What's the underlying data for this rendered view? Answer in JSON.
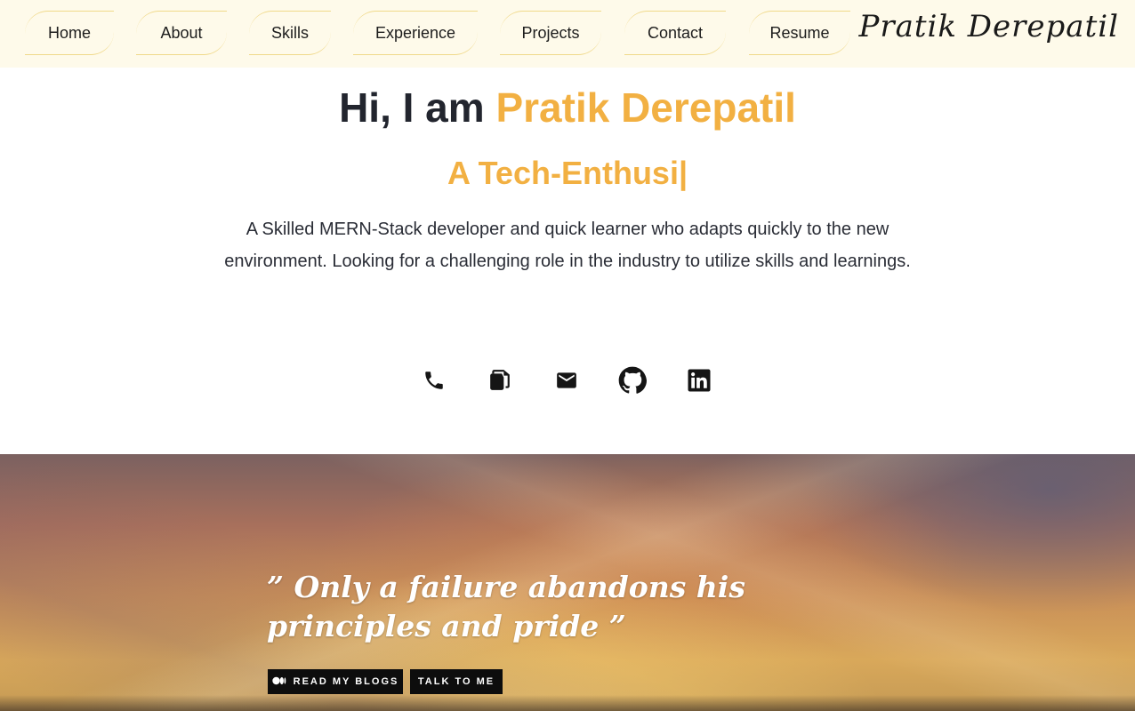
{
  "nav": {
    "items": [
      {
        "label": "Home"
      },
      {
        "label": "About"
      },
      {
        "label": "Skills"
      },
      {
        "label": "Experience"
      },
      {
        "label": "Projects"
      },
      {
        "label": "Contact"
      },
      {
        "label": "Resume"
      }
    ],
    "brand": "Pratik Derepatil"
  },
  "hero": {
    "greeting": "Hi, I am ",
    "name": "Pratik Derepatil",
    "typed_text": "A Tech-Enthusi|",
    "bio": "A Skilled MERN-Stack developer and quick learner who adapts quickly to the new environment. Looking for a challenging role in the industry to utilize skills and learnings."
  },
  "social_icons": [
    "phone-icon",
    "copy-icon",
    "email-icon",
    "github-icon",
    "linkedin-icon"
  ],
  "banner": {
    "quote_open": "” ",
    "quote": "Only a failure abandons his principles and pride",
    "quote_close": " ”",
    "read_blogs_label": "READ MY BLOGS",
    "talk_label": "TALK TO ME"
  },
  "colors": {
    "accent": "#f2b042",
    "nav_bg": "#fefaea",
    "nav_border": "#f0d98a",
    "text": "#22252e",
    "button_bg": "#0d0d0d"
  }
}
